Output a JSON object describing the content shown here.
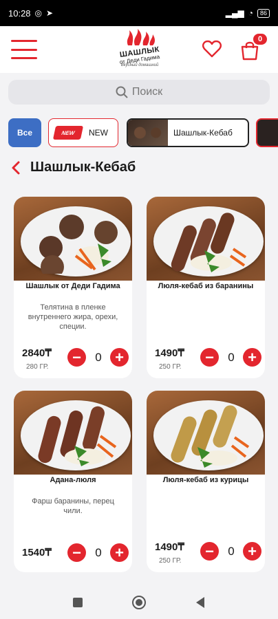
{
  "status": {
    "time": "10:28",
    "battery": "86"
  },
  "header": {
    "logo_line1": "ШАШЛЫК",
    "logo_line2": "от Деди Гадима",
    "logo_line3": "Вкусный домашний",
    "cart_count": "0"
  },
  "search": {
    "placeholder": "Поиск"
  },
  "categories": {
    "all": "Все",
    "new_badge": "NEW",
    "new": "NEW",
    "kebab": "Шашлык-Кебаб"
  },
  "page": {
    "title": "Шашлык-Кебаб"
  },
  "products": [
    {
      "name": "Шашлык от Деди Гадима",
      "description": "Телятина в пленке внутреннего жира, орехи, специи.",
      "price": "2840₸",
      "weight": "280 ГР.",
      "qty": "0"
    },
    {
      "name": "Люля-кебаб из баранины",
      "description": "",
      "price": "1490₸",
      "weight": "250 ГР.",
      "qty": "0"
    },
    {
      "name": "Адана-люля",
      "description": "Фарш баранины, перец чили.",
      "price": "1540₸",
      "weight": "",
      "qty": "0"
    },
    {
      "name": "Люля-кебаб из курицы",
      "description": "",
      "price": "1490₸",
      "weight": "250 ГР.",
      "qty": "0"
    }
  ],
  "colors": {
    "accent": "#e3262e",
    "chip_blue": "#3d6ec4"
  }
}
